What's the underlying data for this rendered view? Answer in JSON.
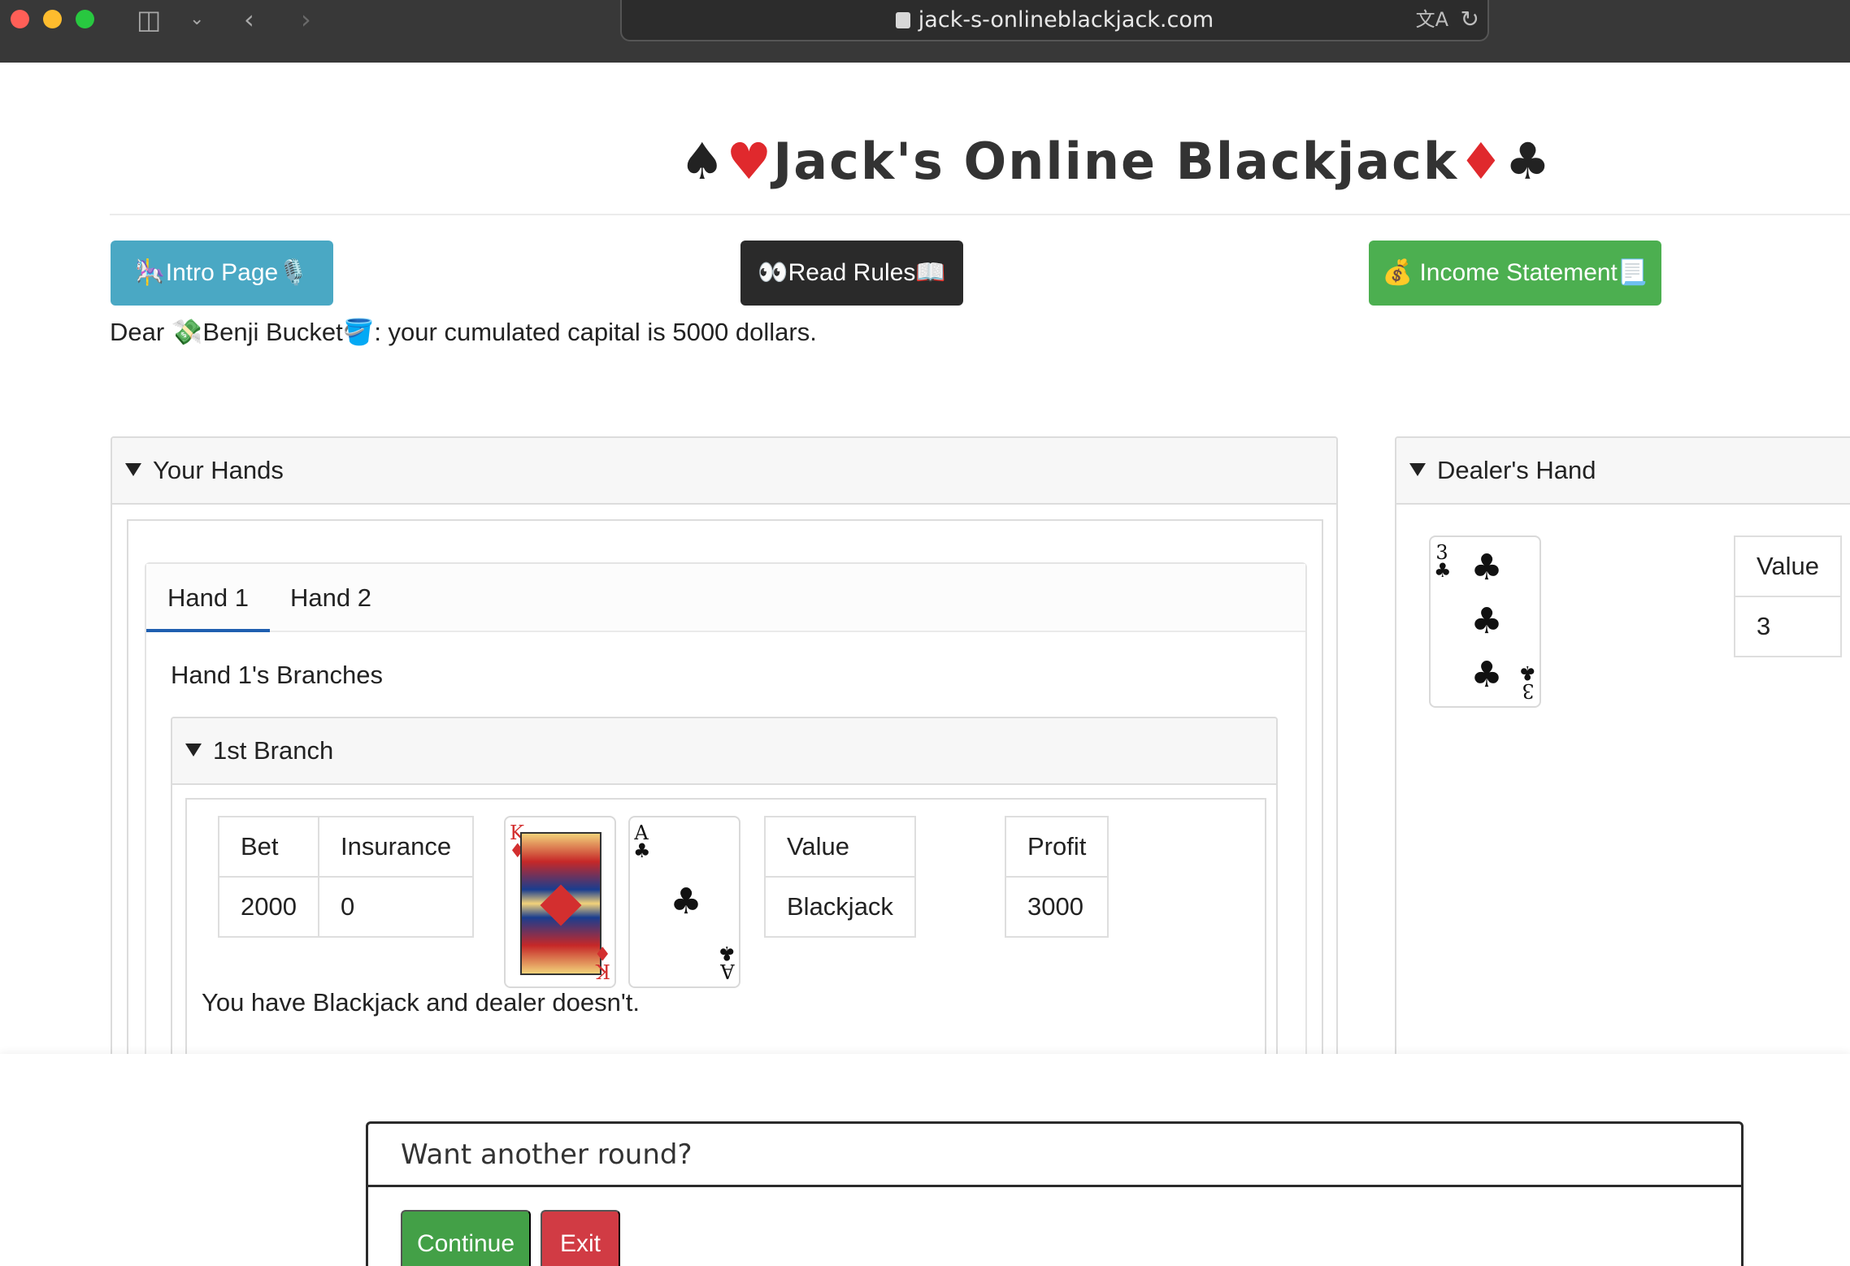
{
  "browser": {
    "url": "jack-s-onlineblackjack.com"
  },
  "page": {
    "title_text": "Jack's Online Blackjack",
    "title_left_suits": [
      "♠",
      "♥"
    ],
    "title_right_suits": [
      "♦",
      "♣"
    ],
    "nav": {
      "intro": "🎠Intro Page🎙️",
      "rules": "👀Read Rules📖",
      "income": "💰 Income Statement📃"
    },
    "greeting": {
      "prefix": "Dear ",
      "player": "💸Benji Bucket🪣",
      "suffix": ": your cumulated capital is 5000 dollars."
    }
  },
  "your_hands": {
    "header": "Your Hands",
    "tabs": [
      "Hand 1",
      "Hand 2"
    ],
    "active_tab": "Hand 1",
    "branches_title": "Hand 1's Branches",
    "branch": {
      "header": "1st Branch",
      "bet_header": "Bet",
      "insurance_header": "Insurance",
      "bet": "2000",
      "insurance": "0",
      "cards": [
        {
          "rank": "K",
          "suit": "♦",
          "color": "#d32f2f"
        },
        {
          "rank": "A",
          "suit": "♣",
          "color": "#111111"
        }
      ],
      "value_header": "Value",
      "value": "Blackjack",
      "profit_header": "Profit",
      "profit": "3000",
      "result": "You have Blackjack and dealer doesn't."
    }
  },
  "dealer": {
    "header": "Dealer's Hand",
    "card": {
      "rank": "3",
      "suit": "♣",
      "color": "#111111"
    },
    "value_header": "Value",
    "value": "3"
  },
  "modal": {
    "title": "Want another round?",
    "continue": "Continue",
    "exit": "Exit"
  },
  "colors": {
    "intro_button": "#4aa8c4",
    "rules_button": "#2a2a2a",
    "income_button": "#4caf50",
    "continue_button": "#43a047",
    "exit_button": "#d13b44",
    "profit_text": "#2e7d32",
    "active_tab_underline": "#1f5fb0"
  }
}
